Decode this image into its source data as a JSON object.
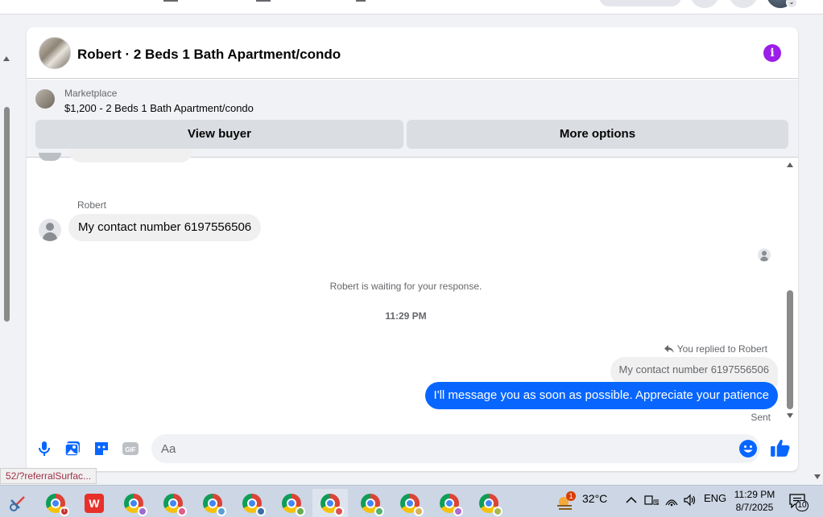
{
  "conversation": {
    "title": "Robert · 2 Beds 1 Bath Apartment/condo",
    "marketplace_label": "Marketplace",
    "listing_title": "$1,200 - 2 Beds 1 Bath Apartment/condo",
    "view_buyer_label": "View buyer",
    "more_options_label": "More options"
  },
  "messages": {
    "sender_name": "Robert",
    "incoming_text": "My contact number 6197556506",
    "waiting_notice": "Robert is waiting for your response.",
    "timestamp": "11:29 PM",
    "replied_label": "You replied to Robert",
    "quoted_text": "My contact number 6197556506",
    "outgoing_text": "I'll message you as soon as possible. Appreciate your patience",
    "status": "Sent"
  },
  "composer": {
    "placeholder": "Aa",
    "icons": [
      "microphone-icon",
      "photo-icon",
      "sticker-icon",
      "gif-icon",
      "emoji-icon",
      "thumbs-up-icon"
    ],
    "gif_label": "GIF"
  },
  "browser": {
    "status_url": "52/?referralSurfac..."
  },
  "taskbar": {
    "weather_temp": "32°C",
    "weather_badge": "1",
    "language": "ENG",
    "time": "11:29 PM",
    "date": "8/7/2025",
    "notification_count": "10",
    "apps": [
      "snipping-tool",
      "chrome-profile-t",
      "wps-office",
      "chrome-profile",
      "chrome-profile",
      "chrome-profile",
      "chrome-profile",
      "chrome-profile",
      "chrome-profile-active",
      "chrome-profile",
      "chrome-profile",
      "chrome-profile",
      "chrome-profile"
    ],
    "app_letter_t": "T",
    "app_letter_w": "W"
  },
  "colors": {
    "accent_blue": "#0866ff",
    "info_purple": "#9b1fe8",
    "taskbar_bg": "#ccd6e4"
  }
}
